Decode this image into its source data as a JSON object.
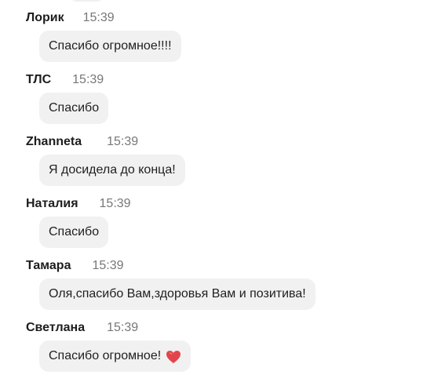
{
  "messages": [
    {
      "author": "Лорик",
      "time": "15:39",
      "text": "Спасибо огромное!!!!"
    },
    {
      "author": "ТЛС",
      "time": "15:39",
      "text": "Спасибо"
    },
    {
      "author": "Zhanneta",
      "time": "15:39",
      "text": "Я досидела до конца!"
    },
    {
      "author": "Наталия",
      "time": "15:39",
      "text": "Спасибо"
    },
    {
      "author": "Тамара",
      "time": "15:39",
      "text": "Оля,спасибо Вам,здоровья Вам и позитива!"
    },
    {
      "author": "Светлана",
      "time": "15:39",
      "text": "Спасибо огромное!",
      "emoji": "heart-icon"
    }
  ],
  "colors": {
    "bubble_background": "#f1f1f1",
    "time_text": "#777777",
    "heart": "#e2444c"
  }
}
